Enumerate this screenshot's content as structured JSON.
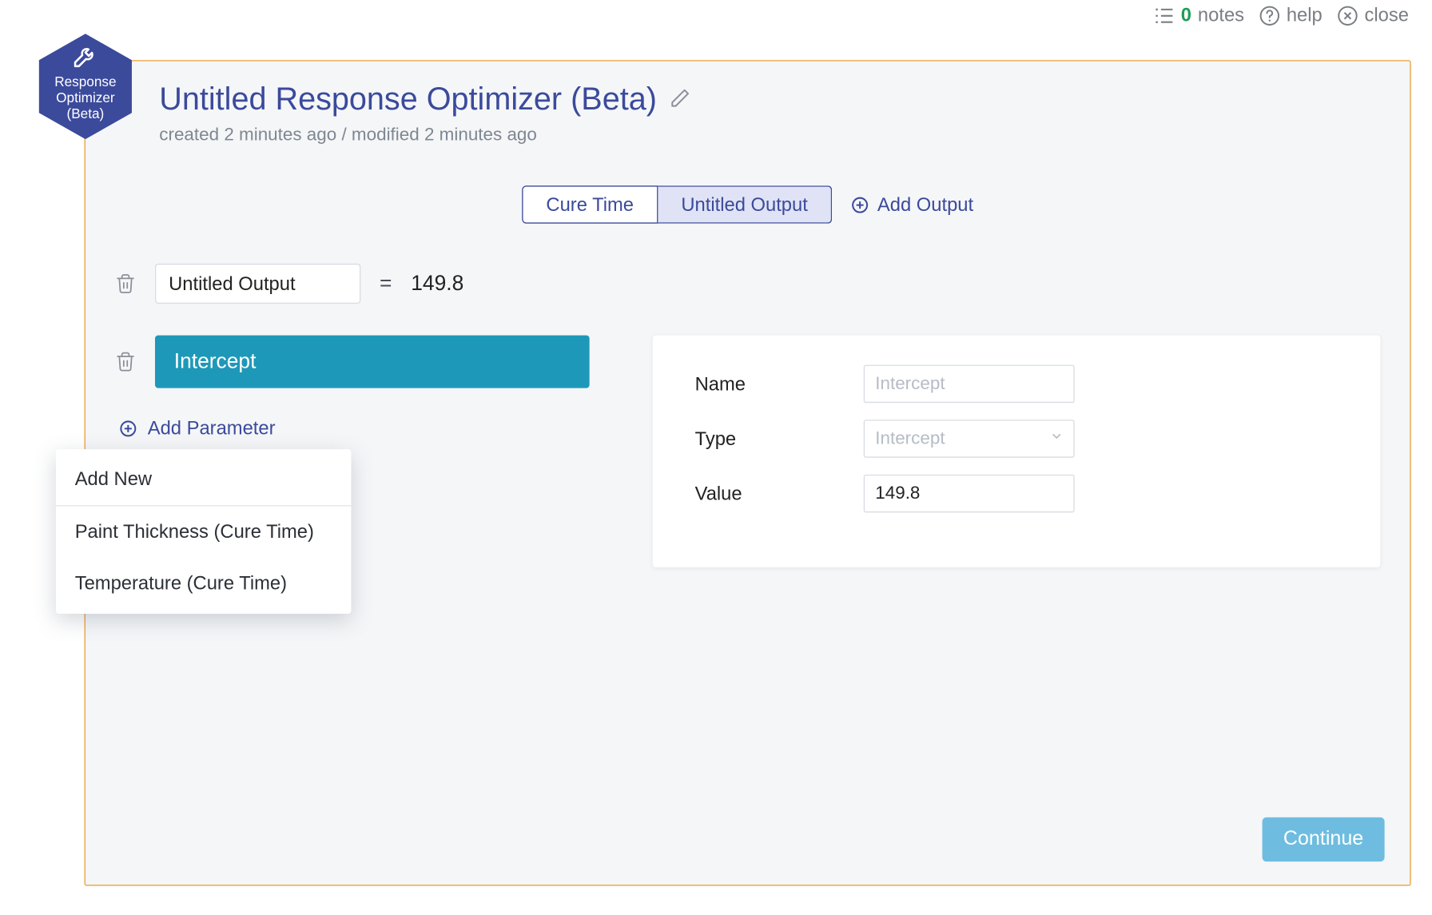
{
  "top": {
    "notes_count": "0",
    "notes_label": "notes",
    "help_label": "help",
    "close_label": "close"
  },
  "badge": {
    "line1": "Response",
    "line2": "Optimizer",
    "line3": "(Beta)"
  },
  "header": {
    "title": "Untitled Response Optimizer (Beta)",
    "subtitle": "created 2 minutes ago / modified 2 minutes ago"
  },
  "tabs": {
    "tab1": "Cure Time",
    "tab2": "Untitled Output",
    "add_output": "Add Output"
  },
  "output": {
    "name_value": "Untitled Output",
    "equals": "=",
    "value": "149.8"
  },
  "left": {
    "intercept_label": "Intercept",
    "add_parameter": "Add Parameter"
  },
  "dropdown": {
    "add_new": "Add New",
    "opt1": "Paint Thickness (Cure Time)",
    "opt2": "Temperature (Cure Time)"
  },
  "form": {
    "name_label": "Name",
    "name_placeholder": "Intercept",
    "type_label": "Type",
    "type_value": "Intercept",
    "value_label": "Value",
    "value_value": "149.8"
  },
  "footer": {
    "continue": "Continue"
  }
}
